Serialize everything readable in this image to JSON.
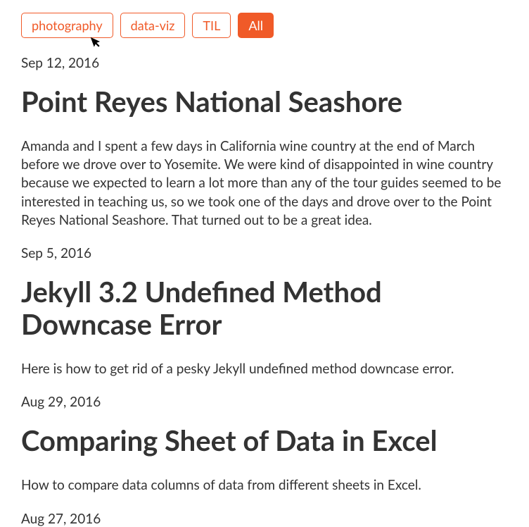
{
  "tags": {
    "items": [
      {
        "label": "photography",
        "active": false
      },
      {
        "label": "data-viz",
        "active": false
      },
      {
        "label": "TIL",
        "active": false
      },
      {
        "label": "All",
        "active": true
      }
    ]
  },
  "posts": [
    {
      "date": "Sep 12, 2016",
      "title": "Point Reyes National Seashore",
      "excerpt": "Amanda and I spent a few days in California wine country at the end of March before we drove over to Yosemite. We were kind of disappointed in wine country because we expected to learn a lot more than any of the tour guides seemed to be interested in teaching us, so we took one of the days and drove over to the Point Reyes National Seashore. That turned out to be a great idea."
    },
    {
      "date": "Sep 5, 2016",
      "title": "Jekyll 3.2 Undefined Method Downcase Error",
      "excerpt": "Here is how to get rid of a pesky Jekyll undefined method downcase error."
    },
    {
      "date": "Aug 29, 2016",
      "title": "Comparing Sheet of Data in Excel",
      "excerpt": "How to compare data columns of data from different sheets in Excel."
    },
    {
      "date": "Aug 27, 2016",
      "title": "",
      "excerpt": ""
    }
  ]
}
